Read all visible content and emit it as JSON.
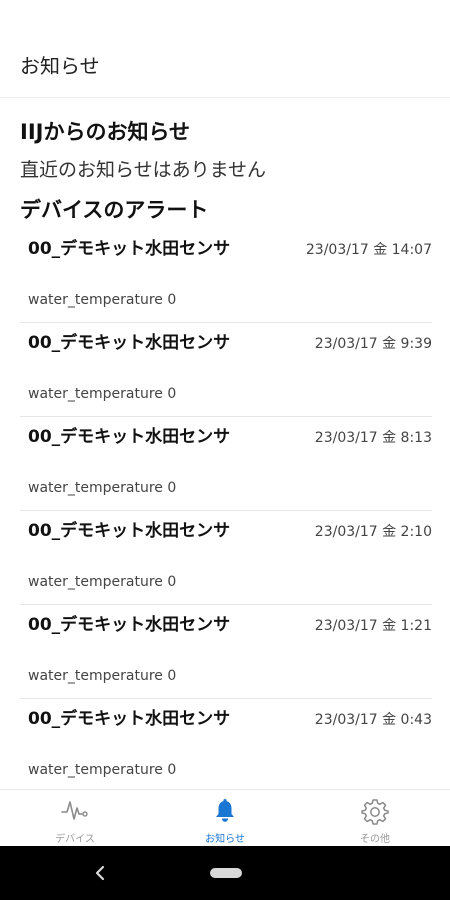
{
  "header": {
    "title": "お知らせ"
  },
  "iij": {
    "title": "IIJからのお知らせ",
    "empty_message": "直近のお知らせはありません"
  },
  "alerts": {
    "title": "デバイスのアラート",
    "items": [
      {
        "name": "00_デモキット水田センサ",
        "time": "23/03/17 金 14:07",
        "detail": "water_temperature 0"
      },
      {
        "name": "00_デモキット水田センサ",
        "time": "23/03/17 金 9:39",
        "detail": "water_temperature 0"
      },
      {
        "name": "00_デモキット水田センサ",
        "time": "23/03/17 金 8:13",
        "detail": "water_temperature 0"
      },
      {
        "name": "00_デモキット水田センサ",
        "time": "23/03/17 金 2:10",
        "detail": "water_temperature 0"
      },
      {
        "name": "00_デモキット水田センサ",
        "time": "23/03/17 金 1:21",
        "detail": "water_temperature 0"
      },
      {
        "name": "00_デモキット水田センサ",
        "time": "23/03/17 金 0:43",
        "detail": "water_temperature 0"
      }
    ]
  },
  "bottom_nav": {
    "items": [
      {
        "label": "デバイス",
        "icon": "pulse-icon",
        "active": false
      },
      {
        "label": "お知らせ",
        "icon": "bell-icon",
        "active": true
      },
      {
        "label": "その他",
        "icon": "gear-icon",
        "active": false
      }
    ]
  },
  "colors": {
    "accent": "#1976d2",
    "inactive": "#9a9a9a"
  }
}
